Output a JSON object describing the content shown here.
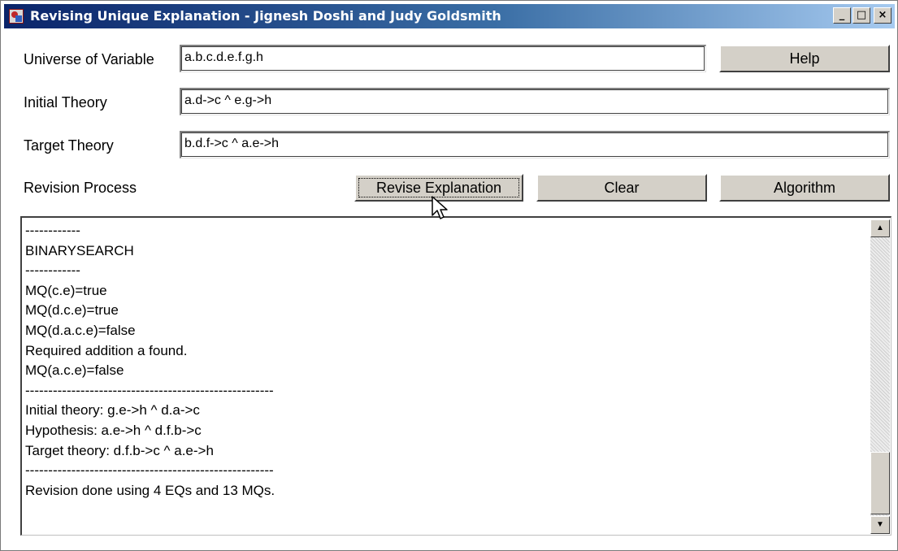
{
  "window": {
    "title": "Revising Unique Explanation - Jignesh Doshi and Judy Goldsmith",
    "controls": {
      "minimize": "_",
      "maximize": "□",
      "close": "×"
    }
  },
  "form": {
    "universe_label": "Universe of Variable",
    "universe_value": "a.b.c.d.e.f.g.h",
    "initial_label": "Initial Theory",
    "initial_value": "a.d->c ^ e.g->h",
    "target_label": "Target Theory",
    "target_value": "b.d.f->c ^ a.e->h",
    "revision_label": "Revision Process"
  },
  "buttons": {
    "help": "Help",
    "revise": "Revise Explanation",
    "clear": "Clear",
    "algorithm": "Algorithm"
  },
  "output": {
    "lines": [
      "------------",
      "BINARYSEARCH",
      "------------",
      "MQ(c.e)=true",
      "MQ(d.c.e)=true",
      "MQ(d.a.c.e)=false",
      "Required addition a found.",
      "MQ(a.c.e)=false",
      "------------------------------------------------------",
      "Initial theory: g.e->h ^ d.a->c",
      "Hypothesis: a.e->h ^ d.f.b->c",
      "Target theory: d.f.b->c ^ a.e->h",
      "------------------------------------------------------",
      "Revision done using 4 EQs and 13 MQs."
    ],
    "scroll_up": "▲",
    "scroll_down": "▼"
  }
}
